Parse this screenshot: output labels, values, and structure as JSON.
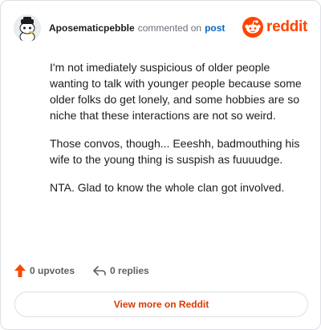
{
  "header": {
    "username": "Aposematicpebble",
    "action_text": "commented on",
    "post_link": "post",
    "brand": "reddit"
  },
  "comment": {
    "paragraphs": [
      "I'm not imediately suspicious of older people wanting to talk with younger people because some older folks do get lonely, and some hobbies are so niche that these interactions are not so weird.",
      "Those convos, though... Eeeshh, badmouthing his wife to the young thing is suspish as fuuuudge.",
      "NTA. Glad to know the whole clan got involved."
    ]
  },
  "actions": {
    "upvotes": "0 upvotes",
    "replies": "0 replies"
  },
  "footer": {
    "view_more": "View more on Reddit"
  },
  "colors": {
    "brand": "#ff4500",
    "link": "#0a66c2",
    "view_more": "#d93a00"
  }
}
